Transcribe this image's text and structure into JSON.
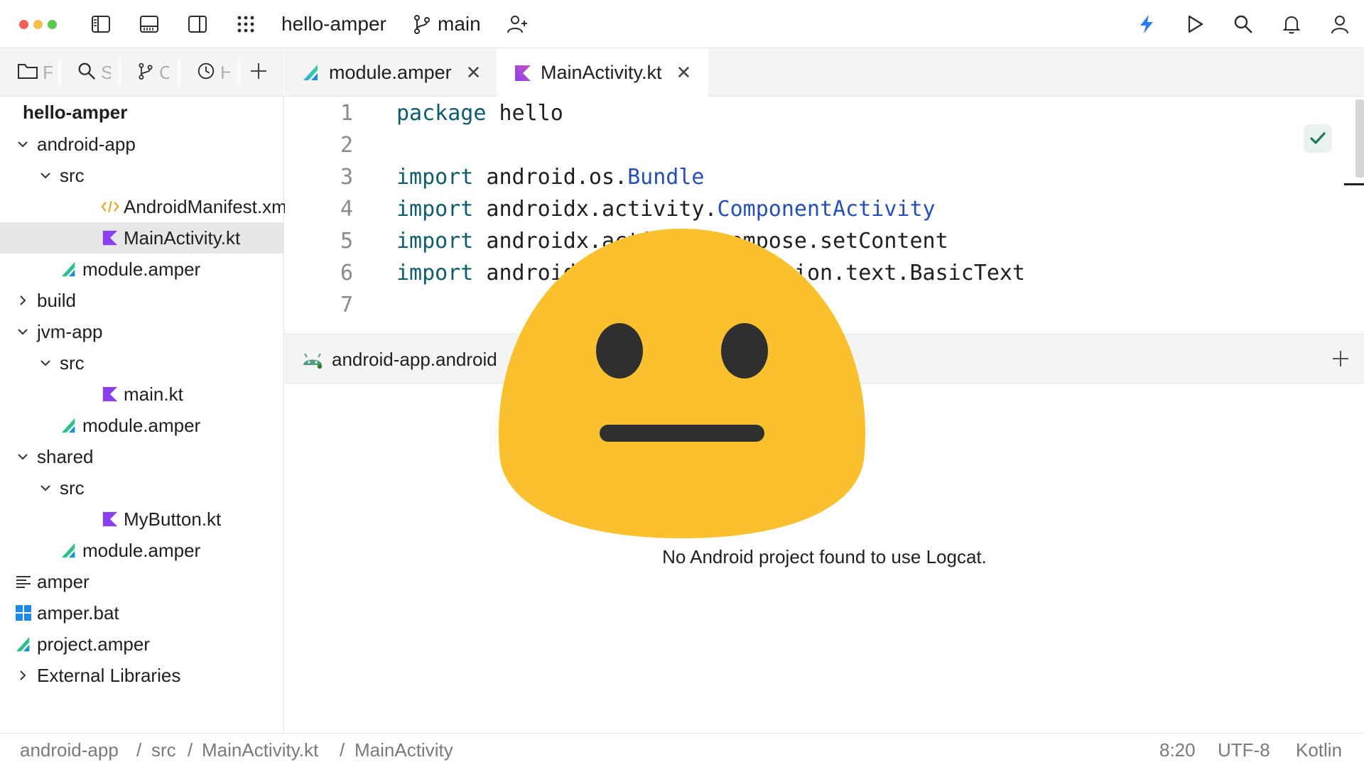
{
  "titlebar": {
    "project_name": "hello-amper",
    "branch": "main",
    "icons": [
      "project-panel-icon",
      "bottom-panel-icon",
      "right-panel-icon",
      "apps-grid-icon",
      "branch-icon",
      "add-user-icon",
      "ai-bolt-icon",
      "run-icon",
      "search-icon",
      "bell-icon",
      "profile-icon"
    ],
    "traffic_colors": [
      "#f0605a",
      "#f4bd4f",
      "#5bc64c"
    ],
    "accent_color": "#2e7cf6"
  },
  "left_panel": {
    "tabs": [
      {
        "icon": "folder-icon",
        "label": "F"
      },
      {
        "icon": "search-icon",
        "label": "S"
      },
      {
        "icon": "commit-icon",
        "label": "C"
      },
      {
        "icon": "history-icon",
        "label": "H"
      }
    ],
    "tree": [
      {
        "label": "hello-amper",
        "depth": 0,
        "kind": "root"
      },
      {
        "label": "android-app",
        "depth": 0,
        "kind": "folder-open"
      },
      {
        "label": "src",
        "depth": 1,
        "kind": "folder-open"
      },
      {
        "label": "AndroidManifest.xml",
        "depth": 2,
        "kind": "xml"
      },
      {
        "label": "MainActivity.kt",
        "depth": 2,
        "kind": "kotlin",
        "selected": true
      },
      {
        "label": "module.amper",
        "depth": 1,
        "kind": "amper"
      },
      {
        "label": "build",
        "depth": 0,
        "kind": "folder-closed"
      },
      {
        "label": "jvm-app",
        "depth": 0,
        "kind": "folder-open"
      },
      {
        "label": "src",
        "depth": 1,
        "kind": "folder-open"
      },
      {
        "label": "main.kt",
        "depth": 2,
        "kind": "kotlin"
      },
      {
        "label": "module.amper",
        "depth": 1,
        "kind": "amper"
      },
      {
        "label": "shared",
        "depth": 0,
        "kind": "folder-open"
      },
      {
        "label": "src",
        "depth": 1,
        "kind": "folder-open"
      },
      {
        "label": "MyButton.kt",
        "depth": 2,
        "kind": "kotlin"
      },
      {
        "label": "module.amper",
        "depth": 1,
        "kind": "amper"
      },
      {
        "label": "amper",
        "depth": 0,
        "kind": "text"
      },
      {
        "label": "amper.bat",
        "depth": 0,
        "kind": "windows"
      },
      {
        "label": "project.amper",
        "depth": 0,
        "kind": "amper"
      },
      {
        "label": "External Libraries",
        "depth": 0,
        "kind": "folder-closed"
      }
    ]
  },
  "editor_tabs": [
    {
      "label": "module.amper",
      "icon": "amper-icon",
      "active": false
    },
    {
      "label": "MainActivity.kt",
      "icon": "kotlin-icon",
      "active": true
    }
  ],
  "code_lines": [
    {
      "num": "1",
      "kw": "package",
      "text": " hello",
      "cls": ""
    },
    {
      "num": "2",
      "kw": "",
      "text": "",
      "cls": ""
    },
    {
      "num": "3",
      "kw": "import",
      "text": " android.os.",
      "cls": "Bundle"
    },
    {
      "num": "4",
      "kw": "import",
      "text": " androidx.activity.",
      "cls": "ComponentActivity"
    },
    {
      "num": "5",
      "kw": "import",
      "text": " androidx.activity.compose.setContent",
      "cls": ""
    },
    {
      "num": "6",
      "kw": "import",
      "text": " androidx.compose.foundation.text.BasicText",
      "cls": ""
    },
    {
      "num": "7",
      "kw": "",
      "text": "",
      "cls": ""
    }
  ],
  "tool_window": {
    "tab_label": "android-app.android",
    "empty_message": "No Android project found to use Logcat."
  },
  "statusbar": {
    "breadcrumbs": [
      "android-app",
      "src",
      "MainActivity.kt",
      "MainActivity"
    ],
    "separator": "/",
    "position": "8:20",
    "encoding": "UTF-8",
    "language": "Kotlin"
  },
  "overlay": {
    "icon": "neutral-face-emoji-icon",
    "color": "#fbc02d"
  }
}
